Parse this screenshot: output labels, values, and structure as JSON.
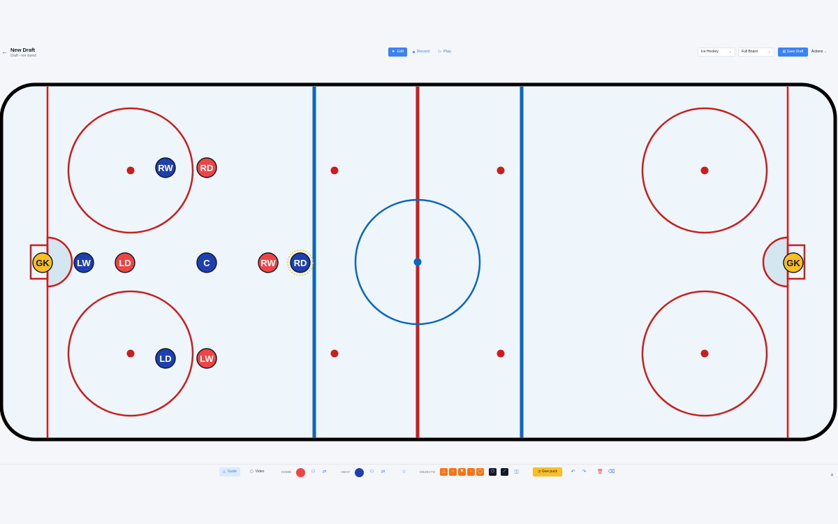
{
  "header": {
    "back_icon": "arrow-left-icon",
    "title": "New Draft",
    "subtitle": "Draft - not saved",
    "modes": [
      {
        "label": "Edit",
        "icon": "cursor-icon",
        "active": true
      },
      {
        "label": "Record",
        "icon": "record-dot-icon",
        "active": false
      },
      {
        "label": "Play",
        "icon": "play-icon",
        "active": false
      }
    ],
    "sport_select": "Ice Hockey",
    "board_select": "Full Board",
    "save_label": "Save Draft",
    "actions_label": "Actions"
  },
  "rink": {
    "colors": {
      "ice": "#eef6fc",
      "red": "#c81e1e",
      "blue": "#0b66c2",
      "border": "#000000",
      "crease": "#d4e7f0"
    },
    "players": [
      {
        "label": "GK",
        "team": "goalie",
        "color": "#fbbf24"
      },
      {
        "label": "LW",
        "team": "home",
        "color": "#1e40af"
      },
      {
        "label": "LD",
        "team": "away",
        "color": "#ef4444"
      },
      {
        "label": "C",
        "team": "home",
        "color": "#1e40af"
      },
      {
        "label": "RW",
        "team": "away",
        "color": "#ef4444"
      },
      {
        "label": "RD",
        "team": "home",
        "color": "#1e40af",
        "selected": true
      },
      {
        "label": "RW",
        "team": "home",
        "color": "#1e40af"
      },
      {
        "label": "RD",
        "team": "away",
        "color": "#ef4444"
      },
      {
        "label": "LD",
        "team": "home",
        "color": "#1e40af"
      },
      {
        "label": "LW",
        "team": "away",
        "color": "#ef4444"
      },
      {
        "label": "GK",
        "team": "goalie",
        "color": "#fbbf24"
      }
    ]
  },
  "toolbar": {
    "guide_label": "Guide",
    "video_label": "Video",
    "home_label": "HOME",
    "home_color": "#ef4444",
    "away_label": "AWAY",
    "away_color": "#1e40af",
    "objects_label": "OBJECTS",
    "objects": [
      {
        "icon": "triangle-icon",
        "color": "#f97316"
      },
      {
        "icon": "circle-icon",
        "color": "#f97316"
      },
      {
        "icon": "flag-icon",
        "color": "#f97316"
      },
      {
        "icon": "minus-icon",
        "color": "#f97316"
      },
      {
        "icon": "ring-icon",
        "color": "#f97316"
      },
      {
        "icon": "hexagon-icon",
        "color": "#111827"
      },
      {
        "icon": "stick-icon",
        "color": "#111827"
      }
    ],
    "give_puck_label": "Give puck"
  }
}
